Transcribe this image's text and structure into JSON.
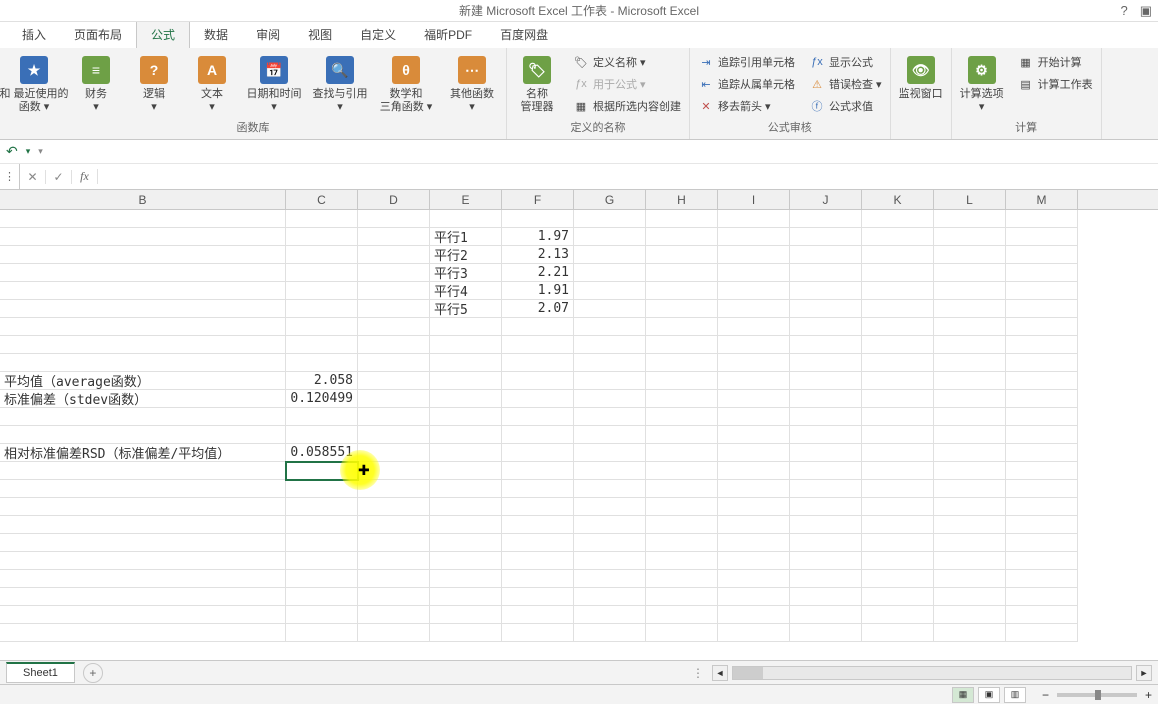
{
  "title": "新建 Microsoft Excel 工作表 - Microsoft Excel",
  "help_icon": "?",
  "ribbon_tabs": [
    "插入",
    "页面布局",
    "公式",
    "数据",
    "审阅",
    "视图",
    "自定义",
    "福昕PDF",
    "百度网盘"
  ],
  "active_tab": "公式",
  "func_lib": {
    "recent_and": "和 最近使用的\n函数 ▾",
    "financial": "财务\n▾",
    "logical": "逻辑\n▾",
    "text": "文本\n▾",
    "date_time": "日期和时间\n▾",
    "lookup": "查找与引用\n▾",
    "math": "数学和\n三角函数 ▾",
    "other": "其他函数\n▾",
    "group": "函数库"
  },
  "names": {
    "name_mgr": "名称\n管理器",
    "define": "定义名称 ▾",
    "use_in": "用于公式 ▾",
    "create_sel": "根据所选内容创建",
    "group": "定义的名称"
  },
  "audit": {
    "trace_pre": "追踪引用单元格",
    "trace_dep": "追踪从属单元格",
    "remove_arrows": "移去箭头 ▾",
    "show_formula": "显示公式",
    "error_check": "错误检查 ▾",
    "evaluate": "公式求值",
    "group": "公式审核"
  },
  "watch": "监视窗口",
  "calc": {
    "options": "计算选项\n▾",
    "calc_now": "开始计算",
    "calc_sheet": "计算工作表",
    "group": "计算"
  },
  "formula_bar": {
    "fx": "fx",
    "value": ""
  },
  "columns": [
    "B",
    "C",
    "D",
    "E",
    "F",
    "G",
    "H",
    "I",
    "J",
    "K",
    "L",
    "M"
  ],
  "cells": {
    "E2": "平行1",
    "F2": "1.97",
    "E3": "平行2",
    "F3": "2.13",
    "E4": "平行3",
    "F4": "2.21",
    "E5": "平行4",
    "F5": "1.91",
    "E6": "平行5",
    "F6": "2.07",
    "B10": "平均值（average函数）",
    "C10": "2.058",
    "B11": "标准偏差（stdev函数）",
    "C11": "0.120499",
    "B14": "相对标准偏差RSD（标准偏差/平均值）",
    "C14": "0.058551"
  },
  "sheet": {
    "name": "Sheet1",
    "add": "+"
  },
  "chart_data": {
    "type": "table",
    "title": "",
    "series": [
      {
        "name": "平行1",
        "value": 1.97
      },
      {
        "name": "平行2",
        "value": 2.13
      },
      {
        "name": "平行3",
        "value": 2.21
      },
      {
        "name": "平行4",
        "value": 1.91
      },
      {
        "name": "平行5",
        "value": 2.07
      }
    ],
    "summary": {
      "average": 2.058,
      "stdev": 0.120499,
      "rsd": 0.058551
    }
  }
}
